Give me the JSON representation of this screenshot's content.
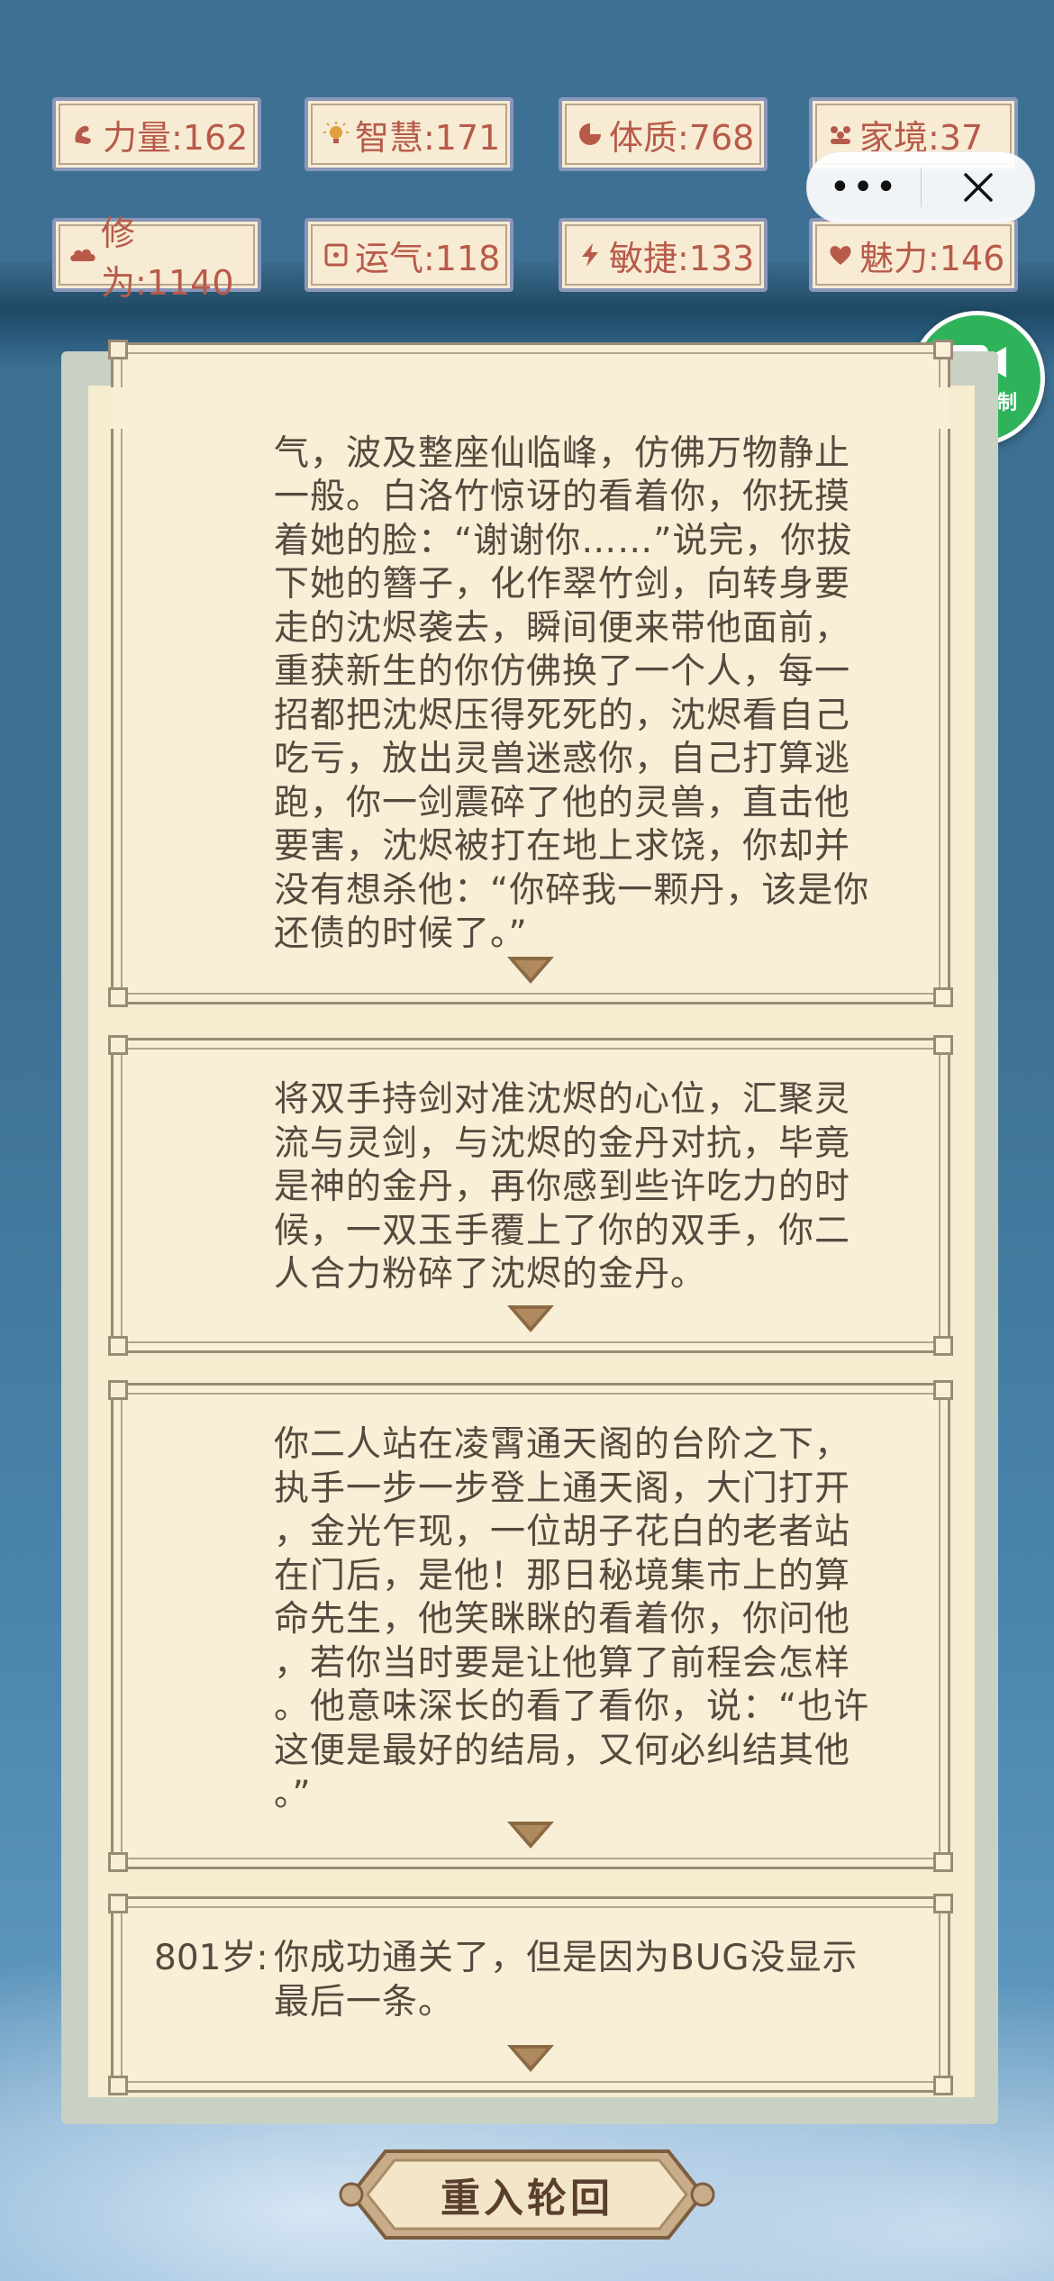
{
  "stats": [
    {
      "icon": "strength-icon",
      "label": "力量:162"
    },
    {
      "icon": "lightbulb-icon",
      "label": "智慧:171"
    },
    {
      "icon": "constitution-icon",
      "label": "体质:768"
    },
    {
      "icon": "family-icon",
      "label": "家境:37"
    },
    {
      "icon": "cloud-icon",
      "label": "修为:1140"
    },
    {
      "icon": "luck-icon",
      "label": "运气:118"
    },
    {
      "icon": "lightning-icon",
      "label": "敏捷:133"
    },
    {
      "icon": "heart-icon",
      "label": "魅力:146"
    }
  ],
  "capsule": {
    "more": "•••",
    "close": "close-icon"
  },
  "record": {
    "label": "暂停录制"
  },
  "events": [
    {
      "age": "",
      "text": "你猛地睁开眼睛，爆出一阵强大的灵\n气，波及整座仙临峰，仿佛万物静止\n一般。白洛竹惊讶的看着你，你抚摸\n着她的脸：“谢谢你……”说完，你拔\n下她的簪子，化作翠竹剑，向转身要\n走的沈烬袭去，瞬间便来带他面前，\n重获新生的你仿佛换了一个人，每一\n招都把沈烬压得死死的，沈烬看自己\n吃亏，放出灵兽迷惑你，自己打算逃\n跑，你一剑震碎了他的灵兽，直击他\n要害，沈烬被打在地上求饶，你却并\n没有想杀他：“你碎我一颗丹，该是你\n还债的时候了。”"
    },
    {
      "age": "",
      "text": "将双手持剑对准沈烬的心位，汇聚灵\n流与灵剑，与沈烬的金丹对抗，毕竟\n是神的金丹，再你感到些许吃力的时\n候，一双玉手覆上了你的双手，你二\n人合力粉碎了沈烬的金丹。"
    },
    {
      "age": "",
      "text": "你二人站在凌霄通天阁的台阶之下，\n执手一步一步登上通天阁，大门打开\n，金光乍现，一位胡子花白的老者站\n在门后，是他！那日秘境集市上的算\n命先生，他笑眯眯的看着你，你问他\n，若你当时要是让他算了前程会怎样\n。他意味深长的看了看你，说：“也许\n这便是最好的结局，又何必纠结其他\n。”"
    },
    {
      "age": "801岁:",
      "text": "你成功通关了，但是因为BUG没显示\n最后一条。"
    }
  ],
  "restart": {
    "label": "重入轮回"
  }
}
